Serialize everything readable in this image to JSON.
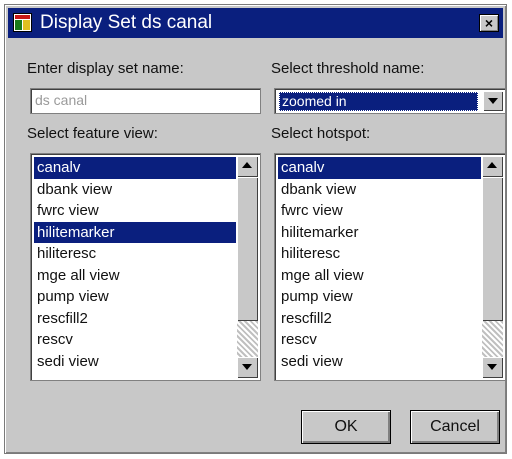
{
  "window": {
    "title": "Display Set ds canal",
    "close_glyph": "×"
  },
  "display_set": {
    "label": "Enter display set name:",
    "value": "ds canal"
  },
  "threshold": {
    "label": "Select threshold name:",
    "selected": "zoomed in"
  },
  "feature_view": {
    "label": "Select feature view:",
    "items": [
      "canalv",
      "dbank view",
      "fwrc view",
      "hilitemarker",
      "hiliteresc",
      "mge all view",
      "pump view",
      "rescfill2",
      "rescv",
      "sedi view"
    ],
    "selected": [
      "canalv",
      "hilitemarker"
    ]
  },
  "hotspot": {
    "label": "Select hotspot:",
    "items": [
      "canalv",
      "dbank view",
      "fwrc view",
      "hilitemarker",
      "hiliteresc",
      "mge all view",
      "pump view",
      "rescfill2",
      "rescv",
      "sedi view"
    ],
    "selected": [
      "canalv"
    ]
  },
  "buttons": {
    "ok": "OK",
    "cancel": "Cancel"
  },
  "colors": {
    "titlebar": "#0a1f7e",
    "selection": "#0a1f7e",
    "dialog_bg": "#c8c8c8"
  }
}
